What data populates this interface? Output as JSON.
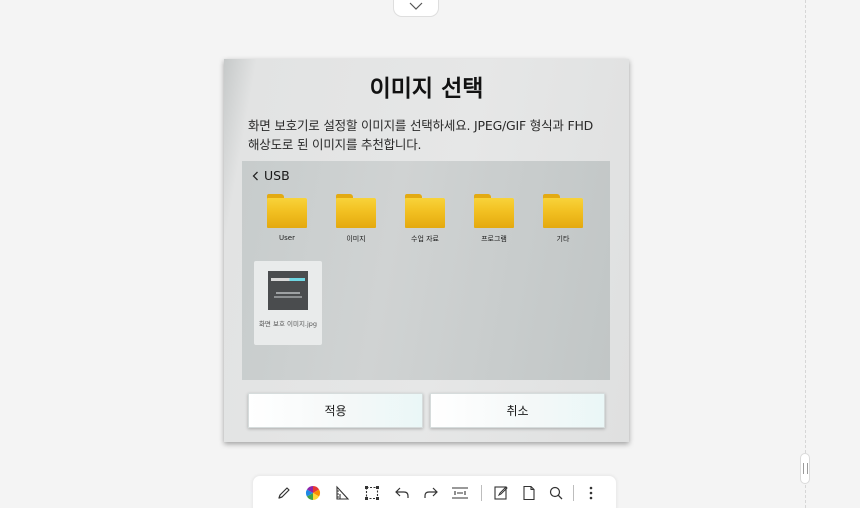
{
  "top_tab": {
    "icon": "chevron-down-icon"
  },
  "dialog": {
    "title": "이미지 선택",
    "description_line1": "화면 보호기로 설정할 이미지를 선택하세요. JPEG/GIF 형식과 FHD",
    "description_line2": "해상도로 된 이미지를 추천합니다.",
    "breadcrumb": {
      "back_icon": "chevron-left-icon",
      "label": "USB"
    },
    "folders": [
      {
        "label": "User",
        "icon": "folder-icon"
      },
      {
        "label": "이미지",
        "icon": "folder-icon"
      },
      {
        "label": "수업 자료",
        "icon": "folder-icon"
      },
      {
        "label": "프로그램",
        "icon": "folder-icon"
      },
      {
        "label": "기타",
        "icon": "folder-icon"
      }
    ],
    "files": [
      {
        "name": "화면 보호 이미지.jpg"
      }
    ],
    "apply_label": "적용",
    "cancel_label": "취소"
  },
  "toolbar": {
    "tools": [
      "pen-icon",
      "color-wheel-icon",
      "ruler-icon",
      "selection-icon",
      "undo-icon",
      "redo-icon",
      "fit-width-icon",
      "edit-page-icon",
      "page-icon",
      "search-icon",
      "more-icon"
    ]
  },
  "colors": {
    "background": "#f4f4f4",
    "folder_yellow": "#f2c021",
    "button_tint": "#eaf7f7"
  }
}
